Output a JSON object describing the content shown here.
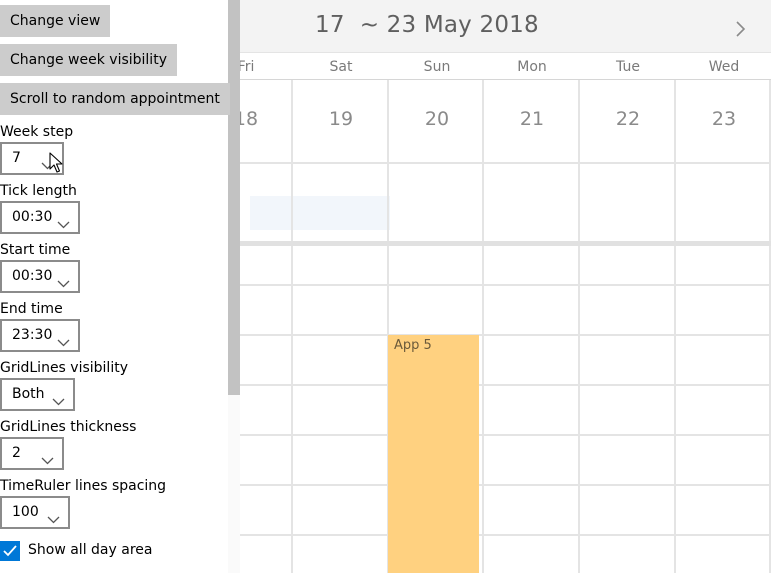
{
  "panel": {
    "buttons": {
      "change_view": "Change view",
      "change_week_visibility": "Change week visibility",
      "scroll_random": "Scroll to random appointment"
    },
    "week_step": {
      "label": "Week step",
      "value": "7"
    },
    "tick_length": {
      "label": "Tick length",
      "value": "00:30"
    },
    "start_time": {
      "label": "Start time",
      "value": "00:30"
    },
    "end_time": {
      "label": "End time",
      "value": "23:30"
    },
    "gridlines_visibility": {
      "label": "GridLines visibility",
      "value": "Both"
    },
    "gridlines_thickness": {
      "label": "GridLines thickness",
      "value": "2"
    },
    "timeruler_spacing": {
      "label": "TimeRuler lines spacing",
      "value": "100"
    },
    "show_all_day": {
      "label": "Show all day area",
      "checked": true
    }
  },
  "scheduler": {
    "date_range": "17  ~ 23 May 2018",
    "day_names": [
      "Fri",
      "Sat",
      "Sun",
      "Mon",
      "Tue",
      "Wed"
    ],
    "day_numbers": [
      "18",
      "19",
      "20",
      "21",
      "22",
      "23"
    ],
    "appointment": {
      "title": "App 5",
      "color": "#ffd180"
    }
  },
  "colors": {
    "accent": "#0078d7",
    "button_bg": "#cccccc",
    "header_bg": "#f3f3f3"
  },
  "icons": {
    "next": "chevron-right-icon",
    "dropdown": "chevron-down-icon",
    "check": "checkmark-icon",
    "cursor": "mouse-pointer-icon"
  }
}
